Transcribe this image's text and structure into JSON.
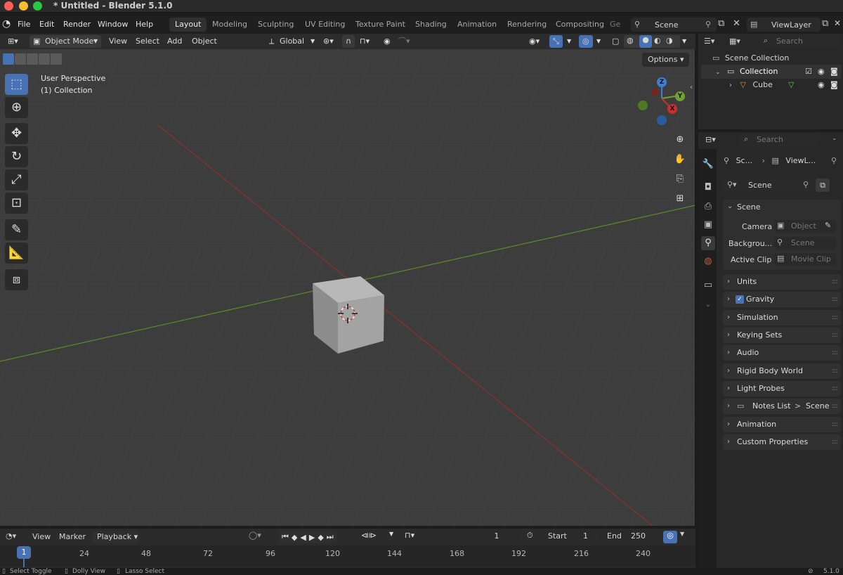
{
  "window": {
    "title": "* Untitled - Blender 5.1.0"
  },
  "menu": {
    "file": "File",
    "edit": "Edit",
    "render": "Render",
    "window": "Window",
    "help": "Help"
  },
  "workspaces": [
    "Layout",
    "Modeling",
    "Sculpting",
    "UV Editing",
    "Texture Paint",
    "Shading",
    "Animation",
    "Rendering",
    "Compositing",
    "Ge"
  ],
  "top_right": {
    "scene": "Scene",
    "view_layer": "ViewLayer"
  },
  "viewport_header": {
    "mode": "Object Mode",
    "view": "View",
    "select": "Select",
    "add": "Add",
    "object": "Object",
    "orientation": "Global",
    "options": "Options"
  },
  "viewport": {
    "perspective": "User Perspective",
    "collection": "(1) Collection"
  },
  "gizmo": {
    "x": "X",
    "y": "Y",
    "z": "Z"
  },
  "outliner": {
    "search_placeholder": "Search",
    "scene_collection": "Scene Collection",
    "collection": "Collection",
    "cube": "Cube"
  },
  "properties": {
    "search_placeholder": "Search",
    "breadcrumb_scene": "Sc...",
    "breadcrumb_layer": "ViewL...",
    "scene_field": "Scene",
    "scene_panel": "Scene",
    "camera_label": "Camera",
    "camera_value": "Object",
    "background_label": "Backgrou...",
    "background_value": "Scene",
    "active_clip_label": "Active Clip",
    "active_clip_value": "Movie Clip",
    "panels": [
      "Units",
      "Gravity",
      "Simulation",
      "Keying Sets",
      "Audio",
      "Rigid Body World",
      "Light Probes",
      "Notes List",
      "Animation",
      "Custom Properties"
    ],
    "notes_sub": "Scene",
    "gravity_checked": true
  },
  "timeline": {
    "view": "View",
    "marker": "Marker",
    "playback": "Playback",
    "current_frame": "1",
    "start_label": "Start",
    "start": "1",
    "end_label": "End",
    "end": "250",
    "ticks": [
      "1",
      "24",
      "48",
      "72",
      "96",
      "120",
      "144",
      "168",
      "192",
      "216",
      "240"
    ]
  },
  "status": {
    "left1": "Select Toggle",
    "left2": "Dolly View",
    "left3": "Lasso Select",
    "version": "5.1.0"
  },
  "colors": {
    "accent": "#4772b3",
    "x_axis": "#c8302f",
    "y_axis": "#6fa22e",
    "z_axis": "#3d7fd6"
  }
}
